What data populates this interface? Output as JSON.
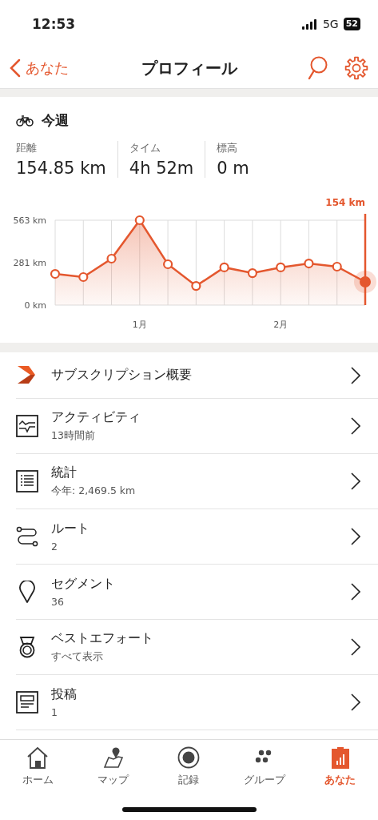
{
  "status_bar": {
    "time": "12:53",
    "network": "5G",
    "battery": "52"
  },
  "nav": {
    "back": "あなた",
    "title": "プロフィール"
  },
  "weekly": {
    "title": "今週",
    "stats": [
      {
        "label": "距離",
        "value": "154.85 km"
      },
      {
        "label": "タイム",
        "value": "4h 52m"
      },
      {
        "label": "標高",
        "value": "0 m"
      }
    ],
    "chart_data": {
      "type": "area",
      "grid": true,
      "categories": [
        null,
        null,
        null,
        "1月",
        null,
        null,
        null,
        null,
        "2月",
        null,
        null,
        null
      ],
      "series": [
        {
          "color": "#e4572e",
          "values": [
            207,
            186,
            308,
            563,
            271,
            127,
            250,
            212,
            250,
            276,
            255,
            154
          ]
        }
      ],
      "ylim": [
        0,
        563
      ],
      "yticks": [
        {
          "value": 0,
          "label": "0 km"
        },
        {
          "value": 281,
          "label": "281 km"
        },
        {
          "value": 563,
          "label": "563 km"
        }
      ],
      "annotations": [
        "154 km"
      ]
    }
  },
  "menu": [
    {
      "kind": "subscription",
      "title": "サブスクリプション概要"
    },
    {
      "kind": "activity",
      "title": "アクティビティ",
      "subtitle": "13時間前"
    },
    {
      "kind": "stats",
      "title": "統計",
      "subtitle": "今年: 2,469.5 km"
    },
    {
      "kind": "route",
      "title": "ルート",
      "subtitle": "2"
    },
    {
      "kind": "segment",
      "title": "セグメント",
      "subtitle": "36"
    },
    {
      "kind": "medal",
      "title": "ベストエフォート",
      "subtitle": "すべて表示"
    },
    {
      "kind": "post",
      "title": "投稿",
      "subtitle": "1"
    }
  ],
  "tabs": [
    {
      "kind": "home",
      "label": "ホーム",
      "selected": false
    },
    {
      "kind": "map",
      "label": "マップ",
      "selected": false
    },
    {
      "kind": "record",
      "label": "記録",
      "selected": false
    },
    {
      "kind": "groups",
      "label": "グループ",
      "selected": false
    },
    {
      "kind": "you",
      "label": "あなた",
      "selected": true
    }
  ]
}
